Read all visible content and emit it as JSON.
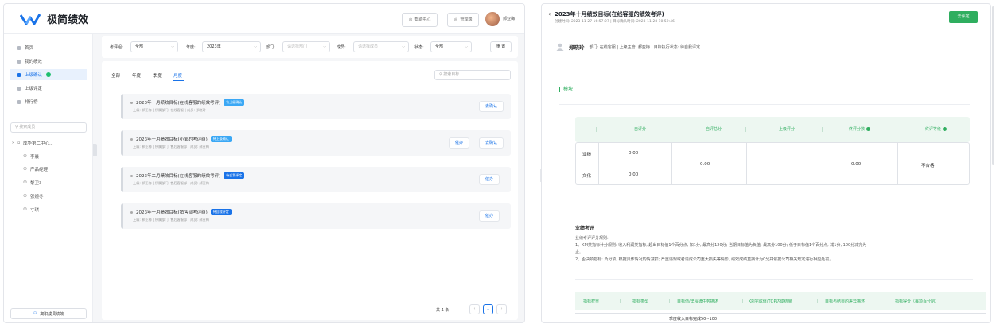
{
  "app": {
    "name": "极简绩效"
  },
  "topbar": {
    "help": "帮助中心",
    "admin": "管理端",
    "user": "郝亚梅"
  },
  "sidebar": {
    "items": [
      {
        "label": "首页"
      },
      {
        "label": "我的绩效"
      },
      {
        "label": "上级确认"
      },
      {
        "label": "上级评定"
      },
      {
        "label": "排行榜"
      }
    ],
    "search_placeholder": "搜索成员",
    "tree_root": "成华第二中心...",
    "tree_members": [
      "李晨",
      "产品经理",
      "黎卫3",
      "张婉冬",
      "寸琪"
    ],
    "bottom_button": "离职成员绩效"
  },
  "filters": {
    "cycle_label": "考评组:",
    "cycle_value": "全部",
    "year_label": "年度:",
    "year_value": "2023年",
    "dept_label": "部门:",
    "dept_placeholder": "请选择部门",
    "member_label": "成员:",
    "member_placeholder": "请选择成员",
    "status_label": "状态:",
    "status_value": "全部",
    "reset": "重 置"
  },
  "list": {
    "tabs": [
      "全部",
      "年度",
      "季度",
      "月度"
    ],
    "search_placeholder": "搜索目标",
    "rows": [
      {
        "title": "2023年十月绩效目标(在线客服的绩效考评)",
        "tag": "待上级确认",
        "meta": "上级: 郝亚梅  |  所属部门: 在线客服  |  成员: 郑晓玲",
        "buttons": [
          "去确认"
        ]
      },
      {
        "title": "2023年十月绩效目标(小邹的考评组)",
        "tag": "待上级确认",
        "meta": "上级: 郝亚梅  |  所属部门: 售后客服部  |  成员: 郝亚梅",
        "buttons": [
          "催办",
          "去确认"
        ]
      },
      {
        "title": "2023年二月绩效目标(在线客服的绩效考评)",
        "tag": "待自我评定",
        "meta": "上级: 郝亚梅  |  所属部门: 售后客服部  |  成员: 郝亚梅",
        "buttons": [
          "催办"
        ]
      },
      {
        "title": "2023年一月绩效目标(销售部考评组)",
        "tag": "待自我评定",
        "meta": "上级: 郝亚梅  |  所属部门: 售后客服部  |  成员: 郝亚梅",
        "buttons": [
          "催办"
        ]
      }
    ],
    "total": "共 4 条",
    "page": "1"
  },
  "detail": {
    "title": "2023年十月绩效目标(在线客服的绩效考评)",
    "sub": "创建时间: 2023-11-27 16:57:27  |  目标确认时间: 2023-11-28 10:59:46",
    "evaluate_button": "去评定",
    "user_name": "郑晓玲",
    "user_info": "部门: 在线客服  |  上级主管: 郝亚梅  |  目标执行状态: 待自我评定",
    "section": "模块",
    "score_headers": [
      "自评分",
      "自评总分",
      "上级评分",
      "终评分数",
      "终评等级"
    ],
    "score_rows": [
      {
        "name": "业绩",
        "self": "0.00"
      },
      {
        "name": "文化",
        "self": "0.00"
      }
    ],
    "self_total": "0.00",
    "final_score": "0.00",
    "final_grade": "不合格",
    "perf_title": "业绩考评",
    "perf_rules": [
      "业绩考评评分规则:",
      "1、KPI类指标计分规则: 收入利润类指标, 超出目标值1个百分点, 加1分, 最高分120分; 当期目标值为负值, 最高分100分; 低于目标值1个百分点, 减1分, 100分减完为",
      "止。",
      "2、否决项指标: 负分项, 根据具体情况酌情减扣; 严重违规或者造成公司重大损失等情形, 绩效成绩直接计为0分并依据公司相关规定进行相应处罚。"
    ],
    "perf_headers": [
      "指标权重",
      "指标类型",
      "目标值/里程碑任务描述",
      "KPI完成值/TOP达成结果",
      "目标与结果的差异描述",
      "指标得分（每项百分制）"
    ],
    "perf_cell_preview": "季度收入目标完成50~100"
  },
  "colors": {
    "accent": "#1a73e8",
    "green": "#2fae5f"
  }
}
